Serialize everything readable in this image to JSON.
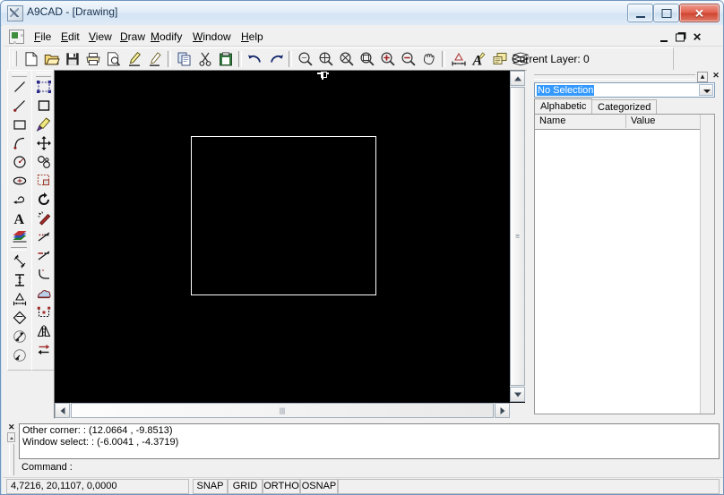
{
  "window": {
    "title": "A9CAD - [Drawing]",
    "icon": "a9cad-app-icon",
    "buttons": {
      "minimize": "minimize-icon",
      "maximize": "maximize-icon",
      "close": "✕"
    }
  },
  "menu": {
    "document_icon": "mdi-document-icon",
    "items": [
      {
        "label": "File",
        "accel": "F"
      },
      {
        "label": "Edit",
        "accel": "E"
      },
      {
        "label": "View",
        "accel": "V"
      },
      {
        "label": "Draw",
        "accel": "D"
      },
      {
        "label": "Modify",
        "accel": "M"
      },
      {
        "label": "Window",
        "accel": "W"
      },
      {
        "label": "Help",
        "accel": "H"
      }
    ],
    "mdi_buttons": [
      "mdi-minimize-icon",
      "mdi-restore-icon",
      "mdi-close-icon"
    ]
  },
  "toolbar": {
    "layer_label": "Current Layer: 0",
    "buttons": [
      {
        "name": "new-icon",
        "tip": "New"
      },
      {
        "name": "open-icon",
        "tip": "Open"
      },
      {
        "name": "save-icon",
        "tip": "Save"
      },
      {
        "name": "print-icon",
        "tip": "Print"
      },
      {
        "name": "print-preview-icon",
        "tip": "Print Preview"
      },
      {
        "name": "edit-pen-icon",
        "tip": "Edit"
      },
      {
        "name": "pick-point-icon",
        "tip": "Pick Point"
      },
      {
        "name": "copy-icon",
        "tip": "Copy"
      },
      {
        "name": "cut-icon",
        "tip": "Cut"
      },
      {
        "name": "paste-icon",
        "tip": "Paste"
      },
      {
        "name": "undo-icon",
        "tip": "Undo"
      },
      {
        "name": "redo-icon",
        "tip": "Redo"
      },
      {
        "name": "zoom-previous-icon",
        "tip": "Zoom Previous"
      },
      {
        "name": "zoom-extents-icon",
        "tip": "Zoom Extents"
      },
      {
        "name": "zoom-window-icon",
        "tip": "Zoom Window"
      },
      {
        "name": "zoom-all-icon",
        "tip": "Zoom All"
      },
      {
        "name": "zoom-in-icon",
        "tip": "Zoom In"
      },
      {
        "name": "zoom-out-icon",
        "tip": "Zoom Out"
      },
      {
        "name": "pan-hand-icon",
        "tip": "Pan"
      },
      {
        "name": "dimension-style-icon",
        "tip": "Dimension Style"
      },
      {
        "name": "text-style-icon",
        "tip": "Text Style"
      },
      {
        "name": "properties-icon",
        "tip": "Properties"
      },
      {
        "name": "layers-icon",
        "tip": "Layers"
      }
    ]
  },
  "tool_palette": {
    "column_a": [
      {
        "name": "line-icon",
        "tip": "Line"
      },
      {
        "name": "polyline-icon",
        "tip": "Polyline"
      },
      {
        "name": "rectangle-icon",
        "tip": "Rectangle"
      },
      {
        "name": "arc-icon",
        "tip": "Arc"
      },
      {
        "name": "circle-icon",
        "tip": "Circle"
      },
      {
        "name": "ellipse-icon",
        "tip": "Ellipse"
      },
      {
        "name": "spline-icon",
        "tip": "Spline"
      },
      {
        "name": "text-icon",
        "tip": "Text"
      },
      {
        "name": "gradient-hatch-icon",
        "tip": "Hatch"
      },
      {
        "name": "dim-aligned-icon",
        "tip": "Aligned Dimension"
      },
      {
        "name": "dim-vertical-icon",
        "tip": "Vertical Dimension"
      },
      {
        "name": "dim-angular-icon",
        "tip": "Angular Dimension"
      },
      {
        "name": "dim-diameter-icon",
        "tip": "Diameter Dimension"
      },
      {
        "name": "dim-radius-icon",
        "tip": "Radius Dimension"
      },
      {
        "name": "dim-center-icon",
        "tip": "Center Mark"
      }
    ],
    "column_b": [
      {
        "name": "select-object-icon",
        "tip": "Select"
      },
      {
        "name": "square-solid-icon",
        "tip": "Solid"
      },
      {
        "name": "match-properties-icon",
        "tip": "Match Properties"
      },
      {
        "name": "move-icon",
        "tip": "Move"
      },
      {
        "name": "copy-object-icon",
        "tip": "Copy Object"
      },
      {
        "name": "scale-icon",
        "tip": "Scale"
      },
      {
        "name": "rotate-icon",
        "tip": "Rotate"
      },
      {
        "name": "erase-icon",
        "tip": "Erase"
      },
      {
        "name": "trim-icon",
        "tip": "Trim"
      },
      {
        "name": "extend-icon",
        "tip": "Extend"
      },
      {
        "name": "fillet-icon",
        "tip": "Fillet"
      },
      {
        "name": "explode-icon",
        "tip": "Explode"
      },
      {
        "name": "stretch-icon",
        "tip": "Stretch"
      },
      {
        "name": "mirror-icon",
        "tip": "Mirror"
      },
      {
        "name": "offset-icon",
        "tip": "Offset"
      }
    ]
  },
  "canvas": {
    "background": "#000000",
    "shape": {
      "type": "rectangle",
      "stroke": "#ffffff"
    },
    "cursor": "crosshair-pick-cursor"
  },
  "properties": {
    "caption_buttons": [
      "collapse-icon",
      "close-icon"
    ],
    "selection": "No Selection",
    "selection_highlight": "#3399ff",
    "tabs": [
      {
        "label": "Alphabetic",
        "active": true
      },
      {
        "label": "Categorized",
        "active": false
      }
    ],
    "grid_headers": [
      "Name",
      "Value"
    ],
    "rows": []
  },
  "command_window": {
    "history": [
      "Other corner: : (12.0664 , -9.8513)",
      "Window  select: : (-6.0041 , -4.3719)"
    ],
    "prompt": "Command :"
  },
  "status_bar": {
    "coordinates": "4,7216, 20,1107, 0,0000",
    "toggles": [
      {
        "label": "SNAP",
        "active": false
      },
      {
        "label": "GRID",
        "active": false
      },
      {
        "label": "ORTHO",
        "active": false
      },
      {
        "label": "OSNAP",
        "active": false
      }
    ]
  }
}
